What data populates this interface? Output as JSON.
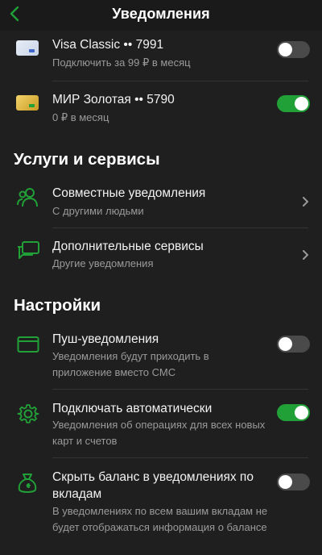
{
  "header": {
    "title": "Уведомления"
  },
  "cards": [
    {
      "name": "Visa Classic •• 7991",
      "price": "Подключить за 99 ₽ в месяц",
      "enabled": false
    },
    {
      "name": "МИР Золотая •• 5790",
      "price": "0 ₽ в месяц",
      "enabled": true
    }
  ],
  "services": {
    "title": "Услуги и сервисы",
    "items": [
      {
        "label": "Совместные уведомления",
        "sub": "С другими людьми"
      },
      {
        "label": "Дополнительные сервисы",
        "sub": "Другие уведомления"
      }
    ]
  },
  "settings": {
    "title": "Настройки",
    "items": [
      {
        "label": "Пуш-уведомления",
        "sub": "Уведомления будут приходить в приложение вместо СМС",
        "enabled": false
      },
      {
        "label": "Подключать автоматически",
        "sub": "Уведомления об операциях для всех новых карт и счетов",
        "enabled": true
      },
      {
        "label": "Скрыть баланс в уведомлениях по вкладам",
        "sub": "В уведомлениях по всем вашим вкладам не будет отображаться информация о балансе",
        "enabled": false
      }
    ]
  },
  "colors": {
    "accent": "#21a038",
    "background": "#1f1f1f",
    "toggle_off": "#4a4a4a"
  }
}
